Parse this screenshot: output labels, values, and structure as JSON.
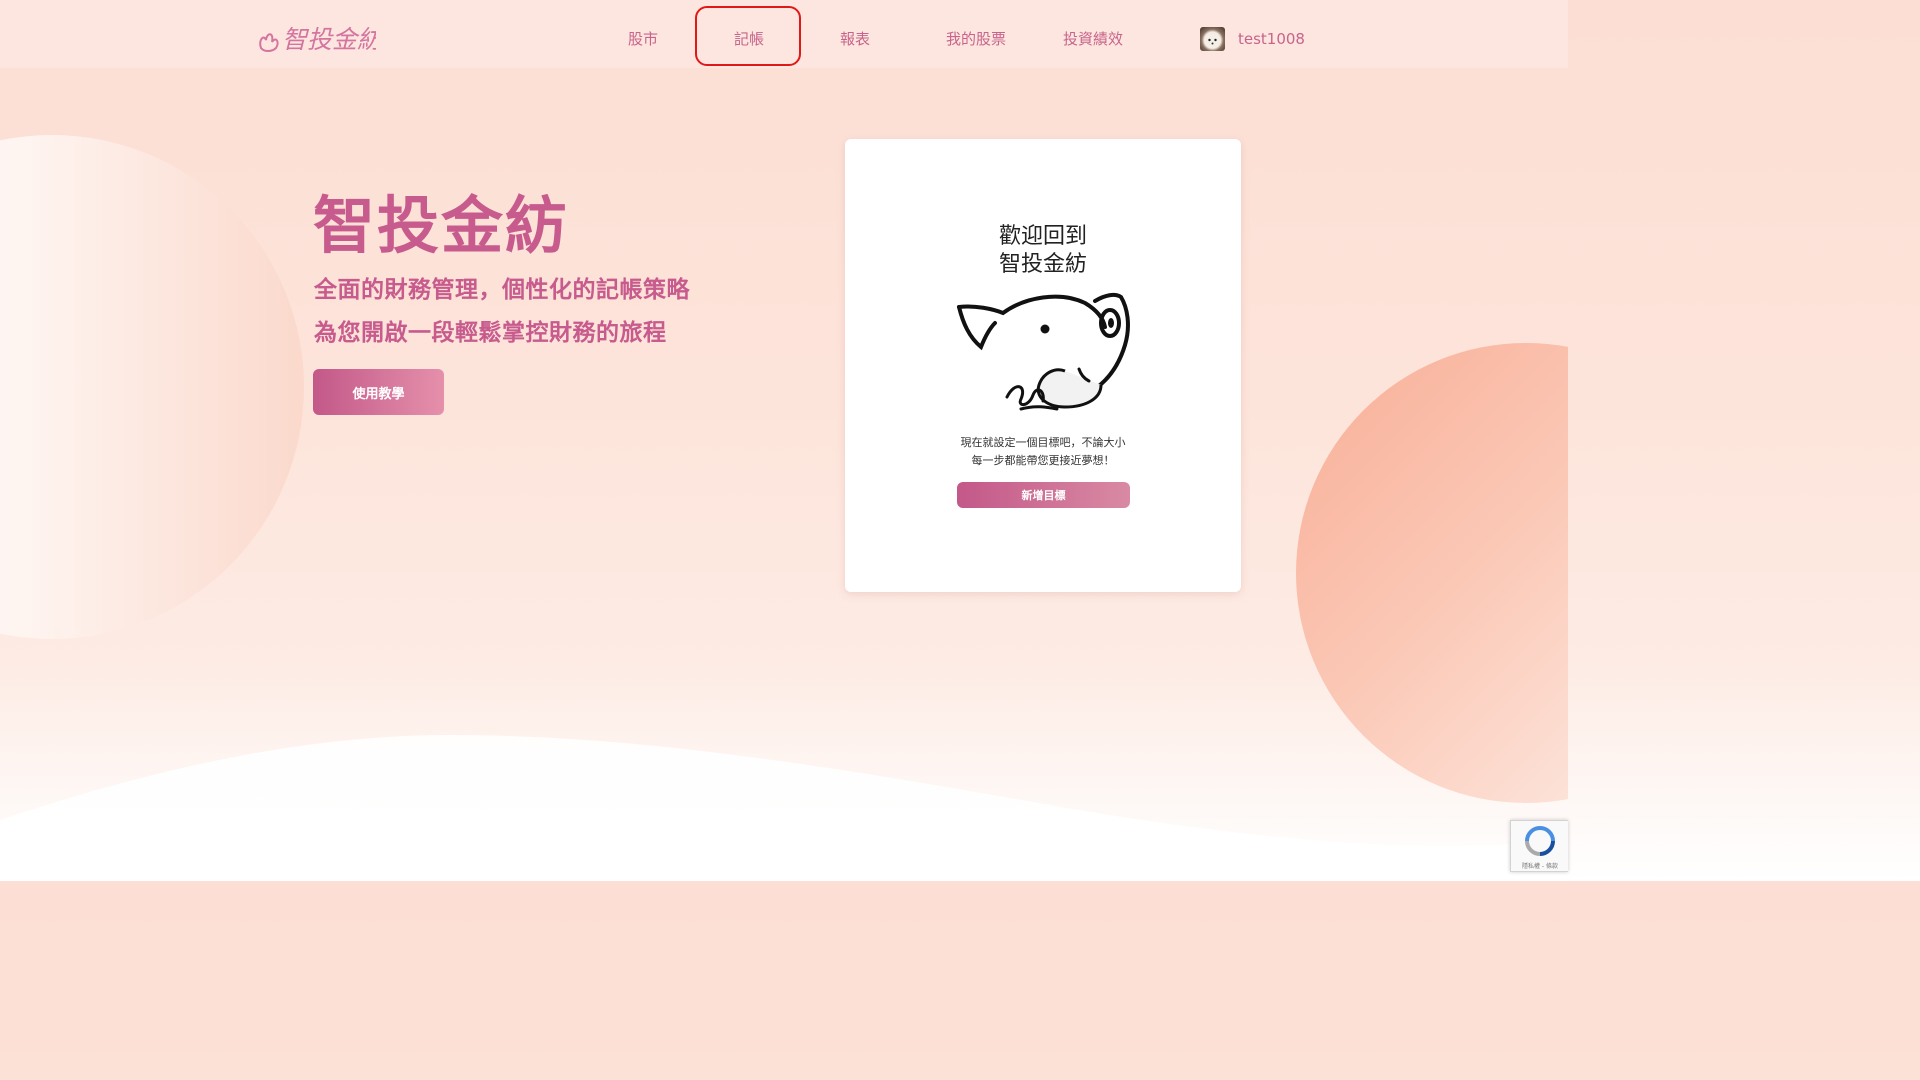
{
  "nav": {
    "logo_text": "智投金紡",
    "links": [
      "股市",
      "記帳",
      "報表",
      "我的股票",
      "投資績效"
    ],
    "highlighted": "記帳",
    "username": "test1008"
  },
  "hero": {
    "title": "智投金紡",
    "subtitle_1": "全面的財務管理，個性化的記帳策略",
    "subtitle_2": "為您開啟一段輕鬆掌控財務的旅程",
    "button_label": "使用教學"
  },
  "card": {
    "title_line_1": "歡迎回到",
    "title_line_2": "智投金紡",
    "text_line_1": "現在就設定一個目標吧，不論大小",
    "text_line_2": "每一步都能帶您更接近夢想！",
    "button_label": "新增目標"
  },
  "recaptcha": {
    "footer_text": "隱私權 - 條款"
  },
  "colors": {
    "brand": "#c75b8d",
    "nav_text": "#c8648c",
    "highlight": "#e01818"
  }
}
